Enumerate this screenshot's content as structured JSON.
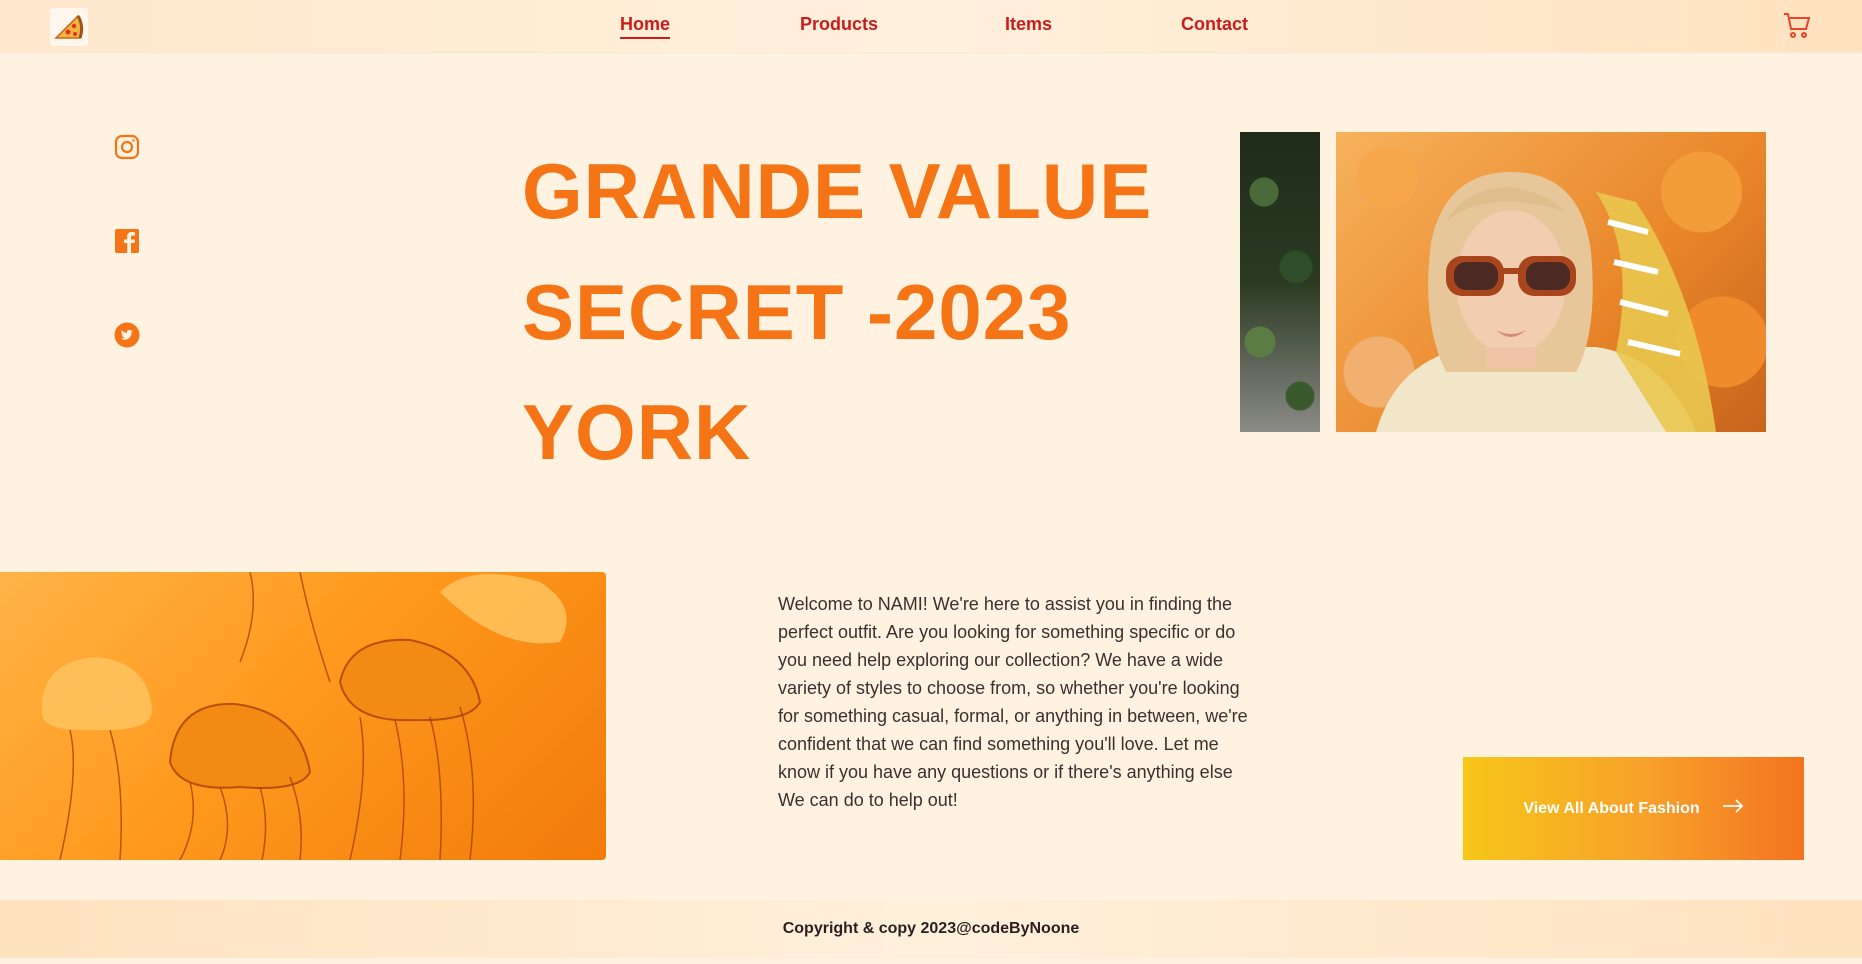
{
  "nav": {
    "logo_icon": "pizza-slice-icon",
    "links": [
      {
        "label": "Home",
        "active": true
      },
      {
        "label": "Products",
        "active": false
      },
      {
        "label": "Items",
        "active": false
      },
      {
        "label": "Contact",
        "active": false
      }
    ],
    "cart_icon": "cart-icon"
  },
  "social": [
    "instagram-icon",
    "facebook-icon",
    "twitter-icon"
  ],
  "hero": {
    "lines": [
      "GRANDE VALUE",
      "SECRET -2023",
      "YORK"
    ]
  },
  "welcome": {
    "text": "Welcome to NAMI! We're here to assist you in finding the perfect outfit. Are you looking for something specific or do you need help exploring our collection? We have a wide variety of styles to choose from, so whether you're looking for something casual, formal, or anything in between, we're confident that we can find something you'll love. Let me know if you have any questions or if there's anything else We can do to help out!"
  },
  "cta": {
    "label": "View All About Fashion",
    "icon": "arrow-right-icon"
  },
  "footer": {
    "text": "Copyright & copy 2023@codeByNoone"
  },
  "colors": {
    "accent": "#f47416",
    "nav_link": "#c81d1d",
    "background": "#fff2e0"
  }
}
